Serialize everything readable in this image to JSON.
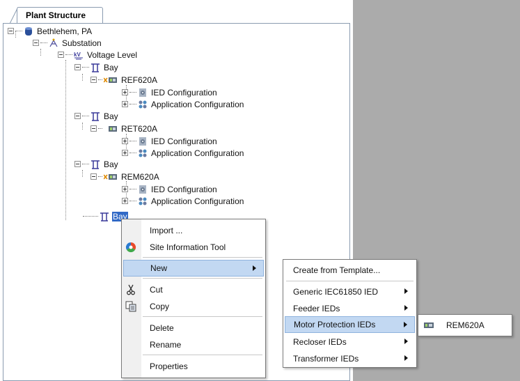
{
  "panel": {
    "tab_title": "Plant Structure"
  },
  "tree": {
    "root": "Bethlehem, PA",
    "substation": "Substation",
    "voltage_level": "Voltage Level",
    "bay1": "Bay",
    "ied1": "REF620A",
    "ied1_cfg": "IED Configuration",
    "ied1_app": "Application Configuration",
    "bay2": "Bay",
    "ied2": "RET620A",
    "ied2_cfg": "IED Configuration",
    "ied2_app": "Application Configuration",
    "bay3": "Bay",
    "ied3": "REM620A",
    "ied3_cfg": "IED Configuration",
    "ied3_app": "Application Configuration",
    "bay4": "Bay"
  },
  "context_menu": {
    "import": "Import ...",
    "site_info": "Site Information Tool",
    "new": "New",
    "cut": "Cut",
    "copy": "Copy",
    "delete": "Delete",
    "rename": "Rename",
    "properties": "Properties"
  },
  "new_submenu": {
    "create_template": "Create from Template...",
    "generic": "Generic IEC61850 IED",
    "feeder": "Feeder IEDs",
    "motor": "Motor Protection IEDs",
    "recloser": "Recloser IEDs",
    "transformer": "Transformer IEDs"
  },
  "motor_submenu": {
    "rem620a": "REM620A"
  },
  "colors": {
    "selection": "#3169c6",
    "menu_highlight": "#c2d8f2",
    "right_pane": "#ababab",
    "database_icon": "#2a4f9a",
    "ied_icon_x": "#e08a00"
  }
}
